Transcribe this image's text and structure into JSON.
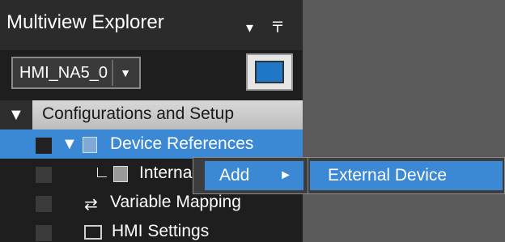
{
  "explorer": {
    "title": "Multiview Explorer",
    "pin_glyphs": "▾ 〒"
  },
  "device_selector": {
    "value": "HMI_NA5_0",
    "arrow": "▼"
  },
  "tree": {
    "configurations": {
      "label": "Configurations and Setup",
      "toggle": "▼"
    },
    "device_references": {
      "label": "Device References",
      "toggle": "▼"
    },
    "internal": {
      "label": "Internal",
      "branch": "∟"
    },
    "variable_mapping": {
      "label": "Variable Mapping",
      "icon": "⇄"
    },
    "hmi_settings": {
      "label": "HMI Settings"
    }
  },
  "context_menu": {
    "add_label": "Add",
    "arrow": "►"
  },
  "submenu": {
    "external_device_label": "External Device"
  },
  "colors": {
    "selection": "#3b88d4",
    "panel_bg": "#1e1e1e",
    "workspace_bg": "#5a5a5a"
  }
}
